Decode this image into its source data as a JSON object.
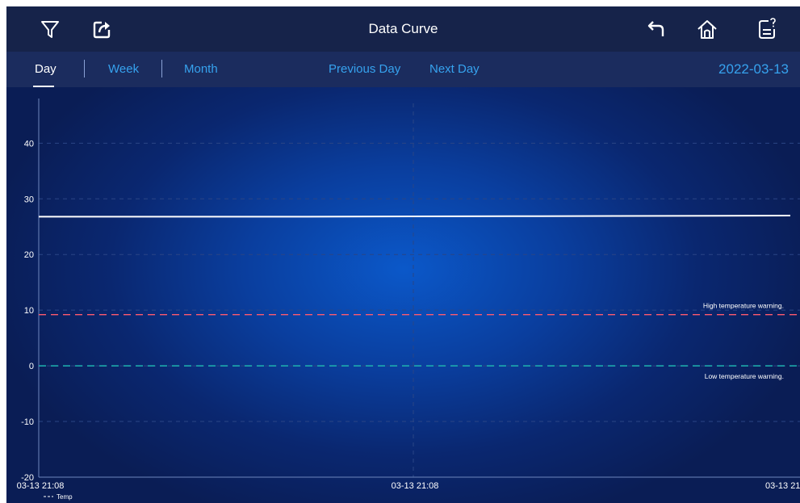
{
  "header": {
    "title": "Data Curve",
    "icons": [
      "filter-icon",
      "export-icon",
      "back-icon",
      "home-icon",
      "report-icon"
    ]
  },
  "nav": {
    "tabs": [
      {
        "label": "Day",
        "active": true
      },
      {
        "label": "Week",
        "active": false
      },
      {
        "label": "Month",
        "active": false
      }
    ],
    "previous_label": "Previous Day",
    "next_label": "Next Day",
    "date": "2022-03-13"
  },
  "colors": {
    "link_blue": "#36a2ee",
    "high_warning": "#ff5a6e",
    "low_warning": "#1fb3b0",
    "series": "#ffffff"
  },
  "chart_data": {
    "type": "line",
    "ylim": [
      -20,
      46
    ],
    "yticks": [
      -20,
      -10,
      0,
      10,
      20,
      30,
      40
    ],
    "ytick_labels": [
      "-20",
      "-10",
      "0",
      "10",
      "20",
      "30",
      "40"
    ],
    "xtick_labels": [
      "03-13 21:08",
      "03-13 21:08",
      "03-13 21"
    ],
    "series": [
      {
        "name": "Temp",
        "values": [
          26.8,
          26.8,
          26.9,
          27.0
        ]
      }
    ],
    "thresholds": [
      {
        "label": "High temperature warning.",
        "value": 9.2
      },
      {
        "label": "Low temperature warning.",
        "value": 0
      }
    ],
    "grid": true,
    "legend": "bottom-left"
  }
}
